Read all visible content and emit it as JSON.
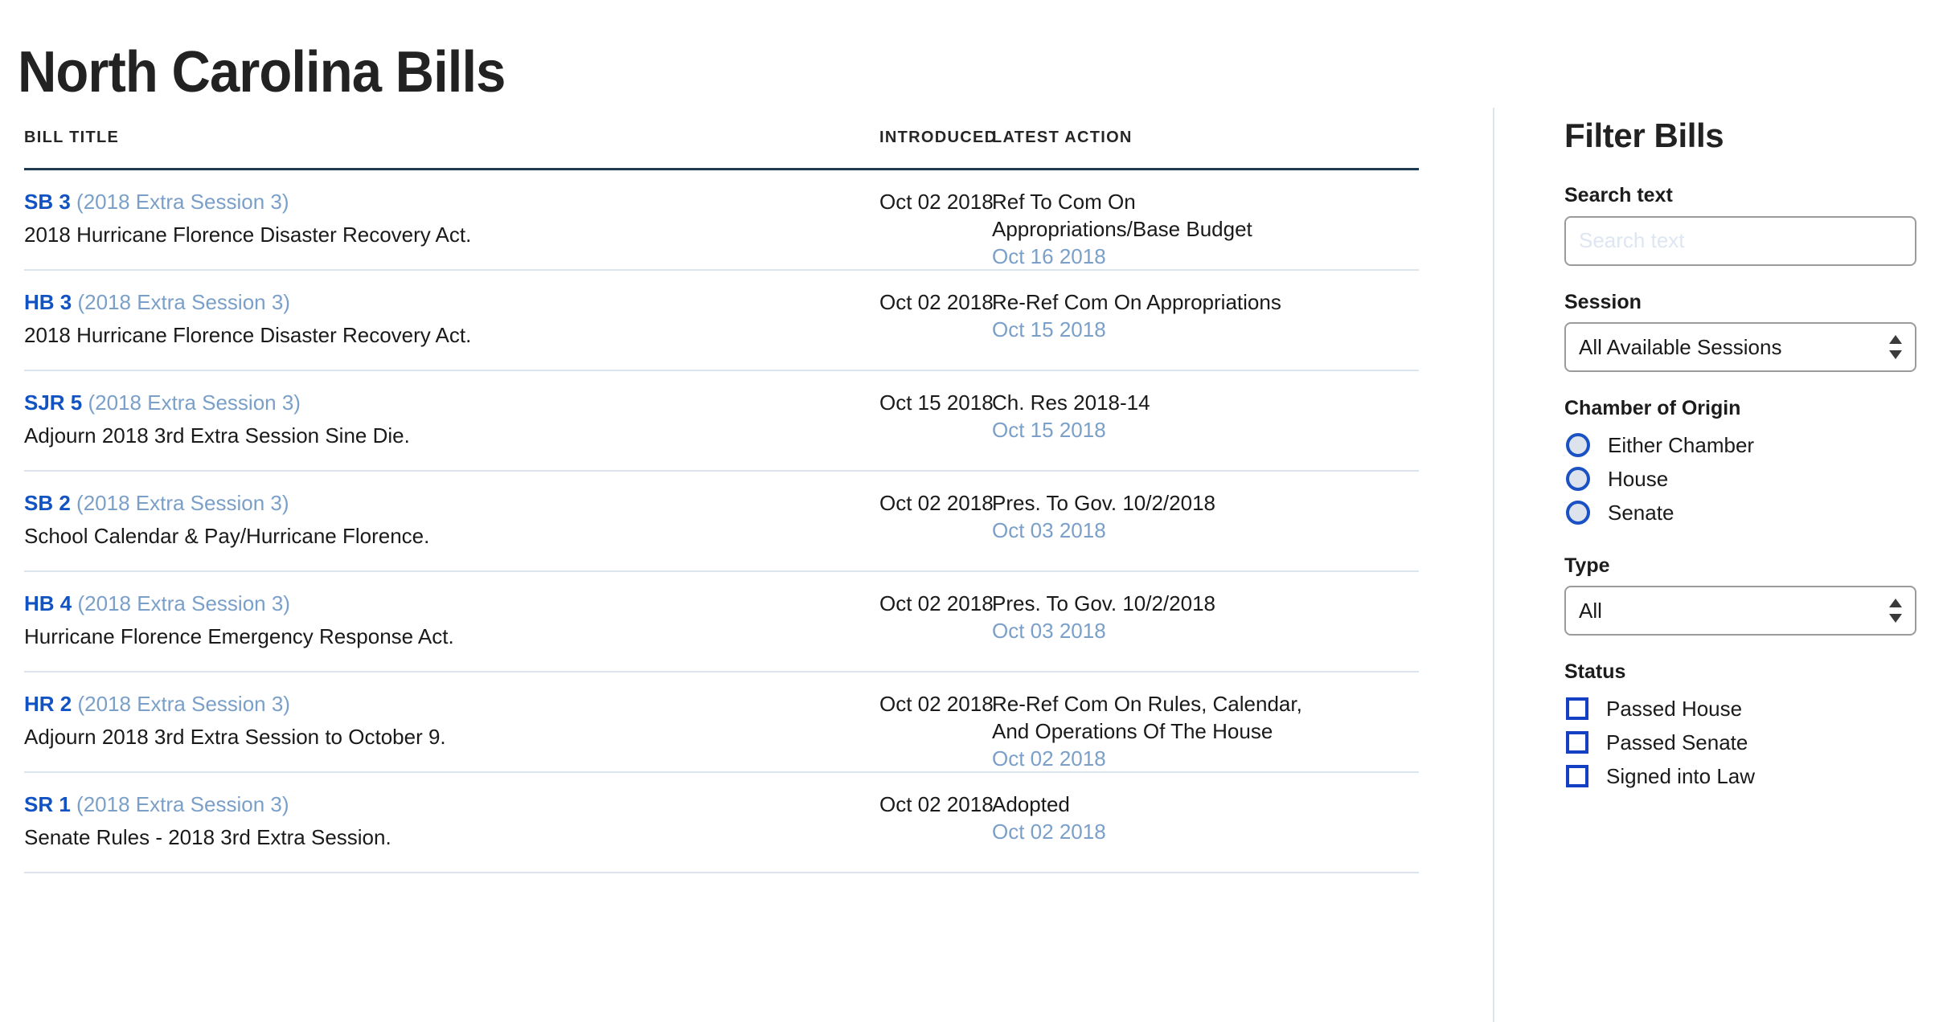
{
  "page": {
    "title": "North Carolina Bills"
  },
  "table": {
    "columns": {
      "bill_title": "BILL TITLE",
      "introduced": "INTRODUCED",
      "latest_action": "LATEST ACTION"
    },
    "rows": [
      {
        "bill_id": "SB 3",
        "session": "(2018 Extra Session 3)",
        "description": "2018 Hurricane Florence Disaster Recovery Act.",
        "introduced": "Oct 02 2018",
        "action_lines": [
          "Ref To Com On",
          "Appropriations/Base Budget"
        ],
        "action_date": "Oct 16 2018"
      },
      {
        "bill_id": "HB 3",
        "session": "(2018 Extra Session 3)",
        "description": "2018 Hurricane Florence Disaster Recovery Act.",
        "introduced": "Oct 02 2018",
        "action_lines": [
          "Re-Ref Com On Appropriations"
        ],
        "action_date": "Oct 15 2018"
      },
      {
        "bill_id": "SJR 5",
        "session": "(2018 Extra Session 3)",
        "description": "Adjourn 2018 3rd Extra Session Sine Die.",
        "introduced": "Oct 15 2018",
        "action_lines": [
          "Ch. Res 2018-14"
        ],
        "action_date": "Oct 15 2018"
      },
      {
        "bill_id": "SB 2",
        "session": "(2018 Extra Session 3)",
        "description": "School Calendar & Pay/Hurricane Florence.",
        "introduced": "Oct 02 2018",
        "action_lines": [
          "Pres. To Gov. 10/2/2018"
        ],
        "action_date": "Oct 03 2018"
      },
      {
        "bill_id": "HB 4",
        "session": "(2018 Extra Session 3)",
        "description": "Hurricane Florence Emergency Response Act.",
        "introduced": "Oct 02 2018",
        "action_lines": [
          "Pres. To Gov. 10/2/2018"
        ],
        "action_date": "Oct 03 2018"
      },
      {
        "bill_id": "HR 2",
        "session": "(2018 Extra Session 3)",
        "description": "Adjourn 2018 3rd Extra Session to October 9.",
        "introduced": "Oct 02 2018",
        "action_lines": [
          "Re-Ref Com On Rules, Calendar,",
          "And Operations Of The House"
        ],
        "action_date": "Oct 02 2018"
      },
      {
        "bill_id": "SR 1",
        "session": "(2018 Extra Session 3)",
        "description": "Senate Rules - 2018 3rd Extra Session.",
        "introduced": "Oct 02 2018",
        "action_lines": [
          "Adopted"
        ],
        "action_date": "Oct 02 2018"
      }
    ]
  },
  "sidebar": {
    "heading": "Filter Bills",
    "search": {
      "label": "Search text",
      "placeholder": "Search text",
      "value": ""
    },
    "session": {
      "label": "Session",
      "selected": "All Available Sessions"
    },
    "chamber": {
      "label": "Chamber of Origin",
      "options": [
        "Either Chamber",
        "House",
        "Senate"
      ]
    },
    "type": {
      "label": "Type",
      "selected": "All"
    },
    "status": {
      "label": "Status",
      "options": [
        "Passed House",
        "Passed Senate",
        "Signed into Law"
      ]
    }
  },
  "colors": {
    "bill_link": "#1253c3",
    "session_text": "#7a9fc9",
    "header_rule": "#1d3c52",
    "row_rule": "#dce5ee",
    "control_accent": "#1540c4"
  }
}
